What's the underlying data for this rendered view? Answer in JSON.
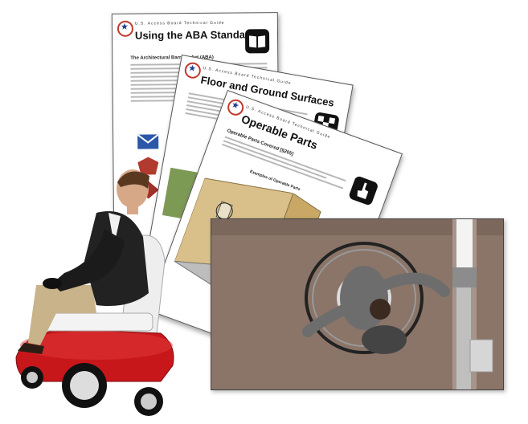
{
  "documents": [
    {
      "header": "U.S. Access Board Technical Guide",
      "title": "Using the ABA Standards",
      "subtitle": "The Architectural Barriers Act (ABA)",
      "icon": "book-icon"
    },
    {
      "header": "U.S. Access Board Technical Guide",
      "title": "Floor and Ground Surfaces",
      "icon": "checkered-floor-icon"
    },
    {
      "header": "U.S. Access Board Technical Guide",
      "title": "Operable Parts",
      "subtitle": "Operable Parts Covered [§205]",
      "figure_caption": "Examples of Operable Parts",
      "icon": "hand-pointer-icon"
    }
  ],
  "colors": {
    "chair_red": "#c8171b",
    "jacket": "#222222",
    "photo_wall": "#8a7568",
    "diagram_wall": "#d9c08a"
  }
}
